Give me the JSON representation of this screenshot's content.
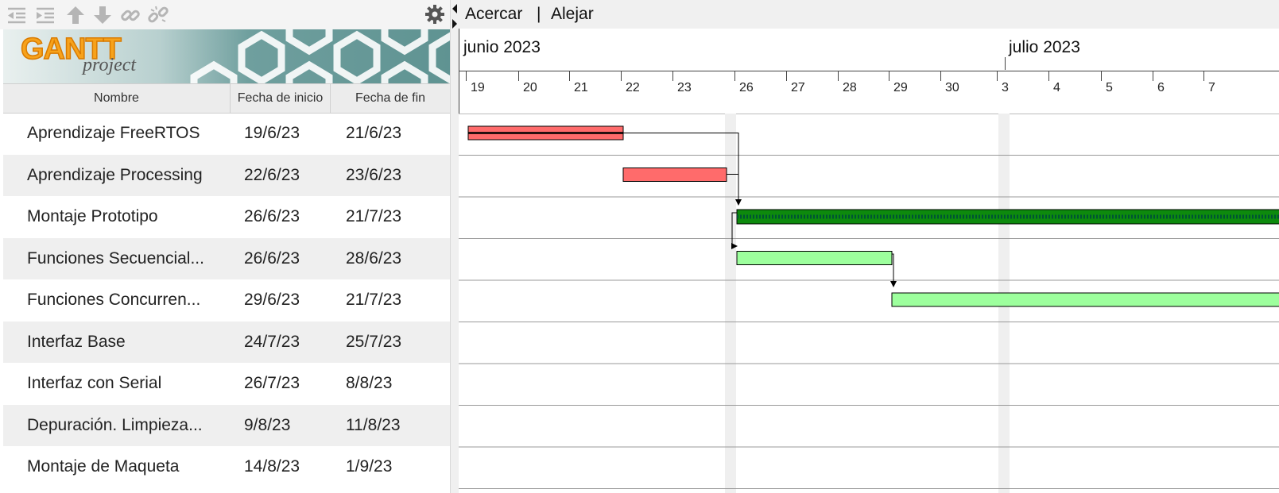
{
  "toolbar": {
    "icons": [
      "outdent-icon",
      "indent-icon",
      "arrow-up-icon",
      "arrow-down-icon",
      "link-icon",
      "unlink-icon",
      "gear-icon"
    ]
  },
  "logo": {
    "main": "GANTT",
    "sub": "project"
  },
  "columns": {
    "name": "Nombre",
    "start": "Fecha de inicio",
    "end": "Fecha de fin"
  },
  "tasks": [
    {
      "name": "Aprendizaje FreeRTOS",
      "start": "19/6/23",
      "end": "21/6/23"
    },
    {
      "name": "Aprendizaje Processing",
      "start": "22/6/23",
      "end": "23/6/23"
    },
    {
      "name": "Montaje Prototipo",
      "start": "26/6/23",
      "end": "21/7/23"
    },
    {
      "name": "Funciones Secuencial...",
      "start": "26/6/23",
      "end": "28/6/23"
    },
    {
      "name": "Funciones Concurren...",
      "start": "29/6/23",
      "end": "21/7/23"
    },
    {
      "name": "Interfaz Base",
      "start": "24/7/23",
      "end": "25/7/23"
    },
    {
      "name": "Interfaz con Serial",
      "start": "26/7/23",
      "end": "8/8/23"
    },
    {
      "name": "Depuración. Limpieza...",
      "start": "9/8/23",
      "end": "11/8/23"
    },
    {
      "name": "Montaje de Maqueta",
      "start": "14/8/23",
      "end": "1/9/23"
    }
  ],
  "zoom": {
    "in": "Acercar",
    "sep": "|",
    "out": "Alejar"
  },
  "timeline": {
    "months": [
      "junio 2023",
      "julio 2023"
    ],
    "days": [
      "19",
      "20",
      "21",
      "22",
      "23",
      "26",
      "27",
      "28",
      "29",
      "30",
      "3",
      "4",
      "5",
      "6",
      "7"
    ]
  },
  "colors": {
    "red_bar": "#ff6b6b",
    "green_bar": "#9dff9d",
    "summary_bar": "#0d8a0d",
    "weekend": "#efefef",
    "banner": "#6a9c9b"
  }
}
